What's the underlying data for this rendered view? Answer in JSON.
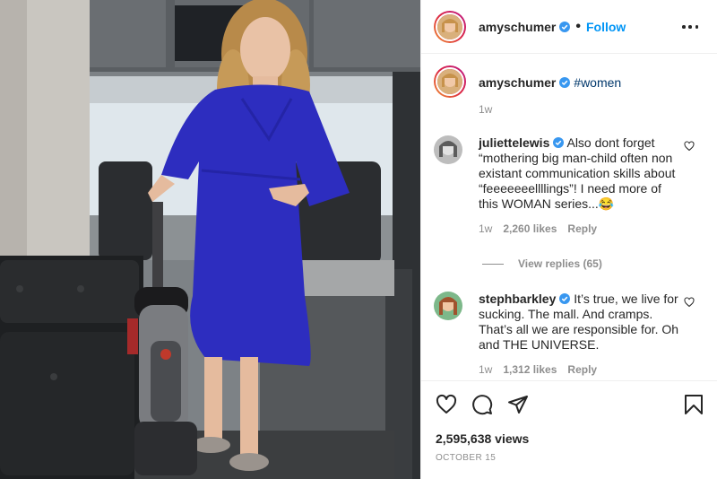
{
  "header": {
    "username": "amyschumer",
    "dot": "•",
    "follow_label": "Follow"
  },
  "caption": {
    "username": "amyschumer",
    "hashtag": "#women",
    "time": "1w"
  },
  "comments": [
    {
      "username": "juliettelewis",
      "text": "Also dont forget “mothering big man-child often non existant communication skills about “feeeeeeellllings”! I need more of this WOMAN series...😂",
      "time": "1w",
      "likes": "2,260 likes",
      "reply_label": "Reply",
      "view_replies": "View replies (65)"
    },
    {
      "username": "stephbarkley",
      "text": "It’s true, we live for sucking. The mall. And cramps. That’s all we are responsible for. Oh and THE UNIVERSE.",
      "time": "1w",
      "likes": "1,312 likes",
      "reply_label": "Reply"
    }
  ],
  "stats": {
    "views": "2,595,638 views",
    "date": "OCTOBER 15"
  },
  "colors": {
    "accent": "#0095f6",
    "verified": "#3897f0",
    "hashtag": "#00376b",
    "muted": "#8e8e8e",
    "dress": "#2d2dbf"
  },
  "icons": [
    "more-options-icon",
    "verified-badge-icon",
    "like-heart-icon",
    "comment-icon",
    "share-icon",
    "bookmark-icon"
  ]
}
